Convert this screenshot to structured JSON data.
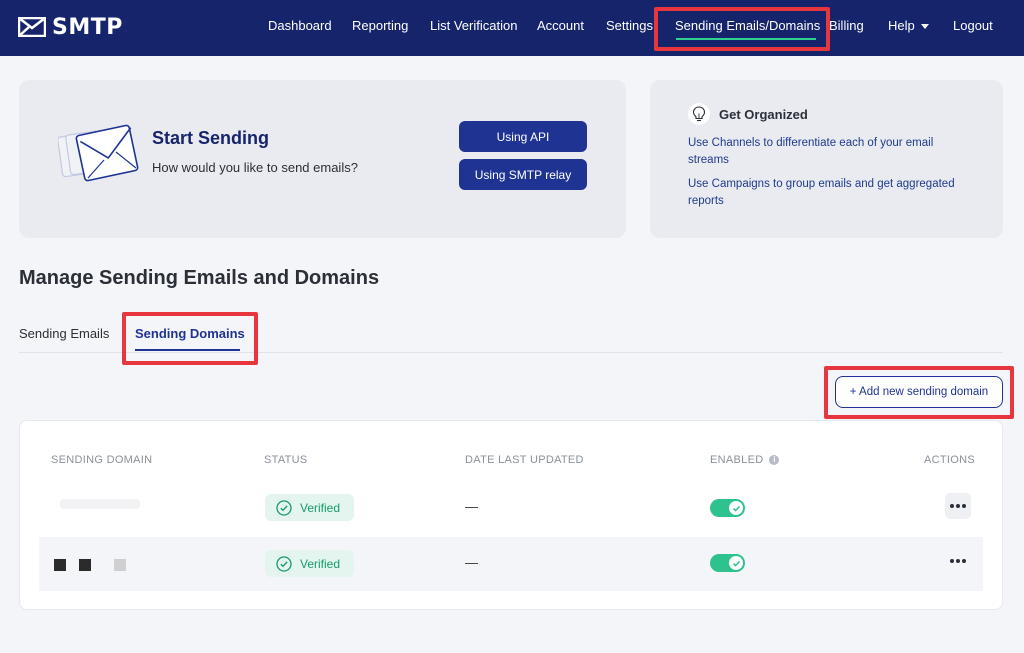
{
  "app": {
    "brand": "SMTP",
    "accent": "#16246b",
    "highlight": "#e8363f"
  },
  "nav": {
    "items": [
      "Dashboard",
      "Reporting",
      "List Verification",
      "Account",
      "Settings",
      "Sending Emails/Domains",
      "Billing",
      "Help",
      "Logout"
    ],
    "active": "Sending Emails/Domains"
  },
  "start": {
    "title": "Start Sending",
    "subtitle": "How would you like to send emails?",
    "btn_api": "Using API",
    "btn_smtp": "Using SMTP relay"
  },
  "organized": {
    "title": "Get Organized",
    "line1": "Use Channels to differentiate each of your email streams",
    "line2": "Use Campaigns to group emails and get aggregated reports"
  },
  "section": {
    "title": "Manage Sending Emails and Domains"
  },
  "tabs": {
    "emails": "Sending Emails",
    "domains": "Sending Domains",
    "active": "Sending Domains"
  },
  "add_button": "+ Add new sending domain",
  "table": {
    "headers": {
      "domain": "SENDING DOMAIN",
      "status": "STATUS",
      "date": "DATE LAST UPDATED",
      "enabled": "ENABLED",
      "actions": "ACTIONS"
    },
    "rows": [
      {
        "status": "Verified",
        "date": "—",
        "enabled": true
      },
      {
        "status": "Verified",
        "date": "—",
        "enabled": true
      }
    ]
  }
}
